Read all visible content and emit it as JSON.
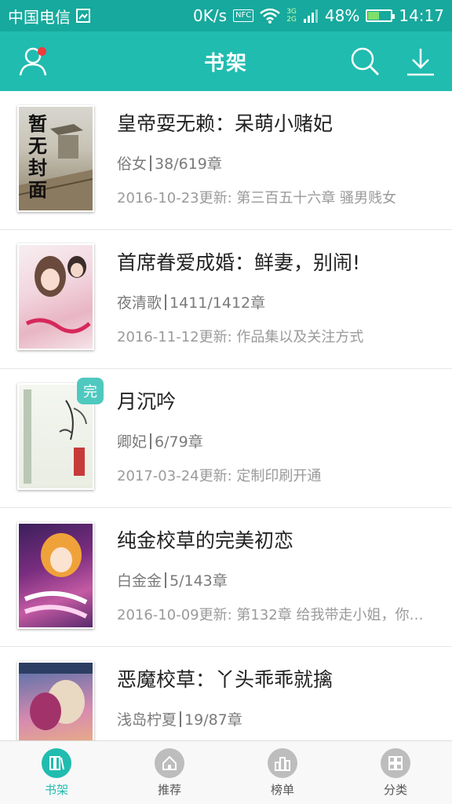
{
  "status_bar": {
    "carrier": "中国电信",
    "net_speed": "0K/s",
    "nfc": "NFC",
    "net_type_top": "3G",
    "net_type_bottom": "2G",
    "battery_percent": "48%",
    "battery_level": 0.48,
    "time": "14:17"
  },
  "app_bar": {
    "title": "书架",
    "profile_icon": "user-icon",
    "search_icon": "search-icon",
    "download_icon": "download-icon"
  },
  "books": [
    {
      "title": "皇帝耍无赖：呆萌小赌妃",
      "author": "俗女",
      "progress": "38/619章",
      "update": "2016-10-23更新: 第三百五十六章 骚男贱女",
      "cover_text": "暂无封面"
    },
    {
      "title": "首席眷爱成婚：鲜妻，别闹!",
      "author": "夜清歌",
      "progress": "1411/1412章",
      "update": "2016-11-12更新: 作品集以及关注方式",
      "cover_text": ""
    },
    {
      "title": "月沉吟",
      "author": "卿妃",
      "progress": "6/79章",
      "update": "2017-03-24更新: 定制印刷开通",
      "badge": "完",
      "cover_text": ""
    },
    {
      "title": "纯金校草的完美初恋",
      "author": "白金金",
      "progress": "5/143章",
      "update": "2016-10-09更新: 第132章 给我带走小姐，你们...",
      "cover_text": ""
    },
    {
      "title": "恶魔校草：丫头乖乖就擒",
      "author": "浅岛柠夏",
      "progress": "19/87章",
      "update": "",
      "cover_text": ""
    }
  ],
  "bottom_nav": [
    {
      "label": "书架",
      "icon": "bookshelf-icon",
      "active": true
    },
    {
      "label": "推荐",
      "icon": "home-icon",
      "active": false
    },
    {
      "label": "榜单",
      "icon": "ranking-icon",
      "active": false
    },
    {
      "label": "分类",
      "icon": "grid-icon",
      "active": false
    }
  ],
  "colors": {
    "status_bar": "#17a99d",
    "app_bar": "#20bcb0",
    "accent": "#20bcb0",
    "badge": "#4fc9bf",
    "notification_dot": "#f03b3b"
  }
}
